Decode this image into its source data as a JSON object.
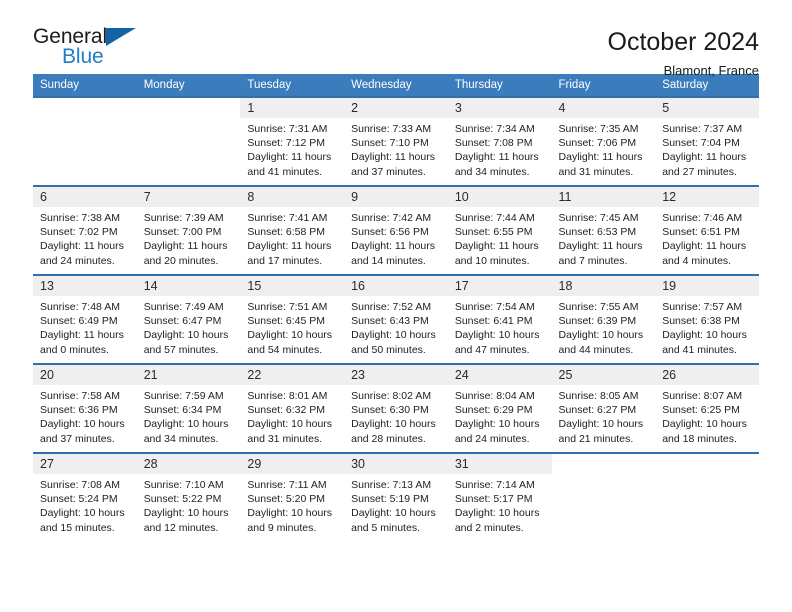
{
  "brand": {
    "name_part1": "General",
    "name_part2": "Blue",
    "accent_color": "#1f7ec4",
    "triangle_color": "#1464a5"
  },
  "header": {
    "title": "October 2024",
    "subtitle": "Blamont, France"
  },
  "theme": {
    "header_row_bg": "#3b7cbd",
    "week_divider": "#2f6fae",
    "daynum_bg": "#efefef"
  },
  "weekday_headers": [
    "Sunday",
    "Monday",
    "Tuesday",
    "Wednesday",
    "Thursday",
    "Friday",
    "Saturday"
  ],
  "weeks": [
    [
      {
        "day": "",
        "sunrise": "",
        "sunset": "",
        "daylight": ""
      },
      {
        "day": "",
        "sunrise": "",
        "sunset": "",
        "daylight": ""
      },
      {
        "day": "1",
        "sunrise": "Sunrise: 7:31 AM",
        "sunset": "Sunset: 7:12 PM",
        "daylight": "Daylight: 11 hours and 41 minutes."
      },
      {
        "day": "2",
        "sunrise": "Sunrise: 7:33 AM",
        "sunset": "Sunset: 7:10 PM",
        "daylight": "Daylight: 11 hours and 37 minutes."
      },
      {
        "day": "3",
        "sunrise": "Sunrise: 7:34 AM",
        "sunset": "Sunset: 7:08 PM",
        "daylight": "Daylight: 11 hours and 34 minutes."
      },
      {
        "day": "4",
        "sunrise": "Sunrise: 7:35 AM",
        "sunset": "Sunset: 7:06 PM",
        "daylight": "Daylight: 11 hours and 31 minutes."
      },
      {
        "day": "5",
        "sunrise": "Sunrise: 7:37 AM",
        "sunset": "Sunset: 7:04 PM",
        "daylight": "Daylight: 11 hours and 27 minutes."
      }
    ],
    [
      {
        "day": "6",
        "sunrise": "Sunrise: 7:38 AM",
        "sunset": "Sunset: 7:02 PM",
        "daylight": "Daylight: 11 hours and 24 minutes."
      },
      {
        "day": "7",
        "sunrise": "Sunrise: 7:39 AM",
        "sunset": "Sunset: 7:00 PM",
        "daylight": "Daylight: 11 hours and 20 minutes."
      },
      {
        "day": "8",
        "sunrise": "Sunrise: 7:41 AM",
        "sunset": "Sunset: 6:58 PM",
        "daylight": "Daylight: 11 hours and 17 minutes."
      },
      {
        "day": "9",
        "sunrise": "Sunrise: 7:42 AM",
        "sunset": "Sunset: 6:56 PM",
        "daylight": "Daylight: 11 hours and 14 minutes."
      },
      {
        "day": "10",
        "sunrise": "Sunrise: 7:44 AM",
        "sunset": "Sunset: 6:55 PM",
        "daylight": "Daylight: 11 hours and 10 minutes."
      },
      {
        "day": "11",
        "sunrise": "Sunrise: 7:45 AM",
        "sunset": "Sunset: 6:53 PM",
        "daylight": "Daylight: 11 hours and 7 minutes."
      },
      {
        "day": "12",
        "sunrise": "Sunrise: 7:46 AM",
        "sunset": "Sunset: 6:51 PM",
        "daylight": "Daylight: 11 hours and 4 minutes."
      }
    ],
    [
      {
        "day": "13",
        "sunrise": "Sunrise: 7:48 AM",
        "sunset": "Sunset: 6:49 PM",
        "daylight": "Daylight: 11 hours and 0 minutes."
      },
      {
        "day": "14",
        "sunrise": "Sunrise: 7:49 AM",
        "sunset": "Sunset: 6:47 PM",
        "daylight": "Daylight: 10 hours and 57 minutes."
      },
      {
        "day": "15",
        "sunrise": "Sunrise: 7:51 AM",
        "sunset": "Sunset: 6:45 PM",
        "daylight": "Daylight: 10 hours and 54 minutes."
      },
      {
        "day": "16",
        "sunrise": "Sunrise: 7:52 AM",
        "sunset": "Sunset: 6:43 PM",
        "daylight": "Daylight: 10 hours and 50 minutes."
      },
      {
        "day": "17",
        "sunrise": "Sunrise: 7:54 AM",
        "sunset": "Sunset: 6:41 PM",
        "daylight": "Daylight: 10 hours and 47 minutes."
      },
      {
        "day": "18",
        "sunrise": "Sunrise: 7:55 AM",
        "sunset": "Sunset: 6:39 PM",
        "daylight": "Daylight: 10 hours and 44 minutes."
      },
      {
        "day": "19",
        "sunrise": "Sunrise: 7:57 AM",
        "sunset": "Sunset: 6:38 PM",
        "daylight": "Daylight: 10 hours and 41 minutes."
      }
    ],
    [
      {
        "day": "20",
        "sunrise": "Sunrise: 7:58 AM",
        "sunset": "Sunset: 6:36 PM",
        "daylight": "Daylight: 10 hours and 37 minutes."
      },
      {
        "day": "21",
        "sunrise": "Sunrise: 7:59 AM",
        "sunset": "Sunset: 6:34 PM",
        "daylight": "Daylight: 10 hours and 34 minutes."
      },
      {
        "day": "22",
        "sunrise": "Sunrise: 8:01 AM",
        "sunset": "Sunset: 6:32 PM",
        "daylight": "Daylight: 10 hours and 31 minutes."
      },
      {
        "day": "23",
        "sunrise": "Sunrise: 8:02 AM",
        "sunset": "Sunset: 6:30 PM",
        "daylight": "Daylight: 10 hours and 28 minutes."
      },
      {
        "day": "24",
        "sunrise": "Sunrise: 8:04 AM",
        "sunset": "Sunset: 6:29 PM",
        "daylight": "Daylight: 10 hours and 24 minutes."
      },
      {
        "day": "25",
        "sunrise": "Sunrise: 8:05 AM",
        "sunset": "Sunset: 6:27 PM",
        "daylight": "Daylight: 10 hours and 21 minutes."
      },
      {
        "day": "26",
        "sunrise": "Sunrise: 8:07 AM",
        "sunset": "Sunset: 6:25 PM",
        "daylight": "Daylight: 10 hours and 18 minutes."
      }
    ],
    [
      {
        "day": "27",
        "sunrise": "Sunrise: 7:08 AM",
        "sunset": "Sunset: 5:24 PM",
        "daylight": "Daylight: 10 hours and 15 minutes."
      },
      {
        "day": "28",
        "sunrise": "Sunrise: 7:10 AM",
        "sunset": "Sunset: 5:22 PM",
        "daylight": "Daylight: 10 hours and 12 minutes."
      },
      {
        "day": "29",
        "sunrise": "Sunrise: 7:11 AM",
        "sunset": "Sunset: 5:20 PM",
        "daylight": "Daylight: 10 hours and 9 minutes."
      },
      {
        "day": "30",
        "sunrise": "Sunrise: 7:13 AM",
        "sunset": "Sunset: 5:19 PM",
        "daylight": "Daylight: 10 hours and 5 minutes."
      },
      {
        "day": "31",
        "sunrise": "Sunrise: 7:14 AM",
        "sunset": "Sunset: 5:17 PM",
        "daylight": "Daylight: 10 hours and 2 minutes."
      },
      {
        "day": "",
        "sunrise": "",
        "sunset": "",
        "daylight": ""
      },
      {
        "day": "",
        "sunrise": "",
        "sunset": "",
        "daylight": ""
      }
    ]
  ]
}
